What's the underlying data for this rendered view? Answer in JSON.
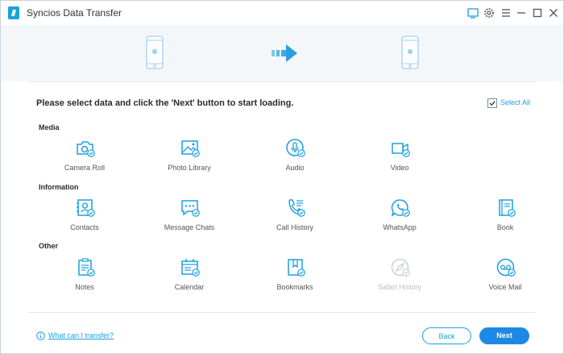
{
  "app": {
    "title": "Syncios Data Transfer"
  },
  "titlebar_icons": [
    "feedback-icon",
    "settings-icon",
    "menu-icon",
    "minimize-icon",
    "maximize-icon",
    "close-icon"
  ],
  "instruction": "Please select data and click the 'Next' button to start loading.",
  "select_all": {
    "label": "Select All",
    "checked": true
  },
  "sections": {
    "media": {
      "title": "Media",
      "items": [
        {
          "label": "Camera Roll",
          "icon": "camera-icon",
          "selected": true
        },
        {
          "label": "Photo Library",
          "icon": "photo-icon",
          "selected": true
        },
        {
          "label": "Audio",
          "icon": "microphone-icon",
          "selected": true
        },
        {
          "label": "Video",
          "icon": "video-icon",
          "selected": true
        }
      ]
    },
    "information": {
      "title": "Information",
      "items": [
        {
          "label": "Contacts",
          "icon": "contacts-icon",
          "selected": true
        },
        {
          "label": "Message Chats",
          "icon": "message-icon",
          "selected": true
        },
        {
          "label": "Call History",
          "icon": "phone-icon",
          "selected": true
        },
        {
          "label": "WhatsApp",
          "icon": "whatsapp-icon",
          "selected": true
        },
        {
          "label": "Book",
          "icon": "book-icon",
          "selected": true
        }
      ]
    },
    "other": {
      "title": "Other",
      "items": [
        {
          "label": "Notes",
          "icon": "notes-icon",
          "selected": true
        },
        {
          "label": "Calendar",
          "icon": "calendar-icon",
          "selected": true
        },
        {
          "label": "Bookmarks",
          "icon": "bookmark-icon",
          "selected": true
        },
        {
          "label": "Safari History",
          "icon": "compass-icon",
          "selected": false,
          "disabled": true
        },
        {
          "label": "Voice Mail",
          "icon": "voicemail-icon",
          "selected": true
        }
      ]
    }
  },
  "help": {
    "label": "What can I transfer?"
  },
  "buttons": {
    "back": "Back",
    "next": "Next"
  },
  "colors": {
    "accent": "#1a9fe0",
    "next_button": "#1e88e5",
    "disabled": "#c9d1d7"
  }
}
